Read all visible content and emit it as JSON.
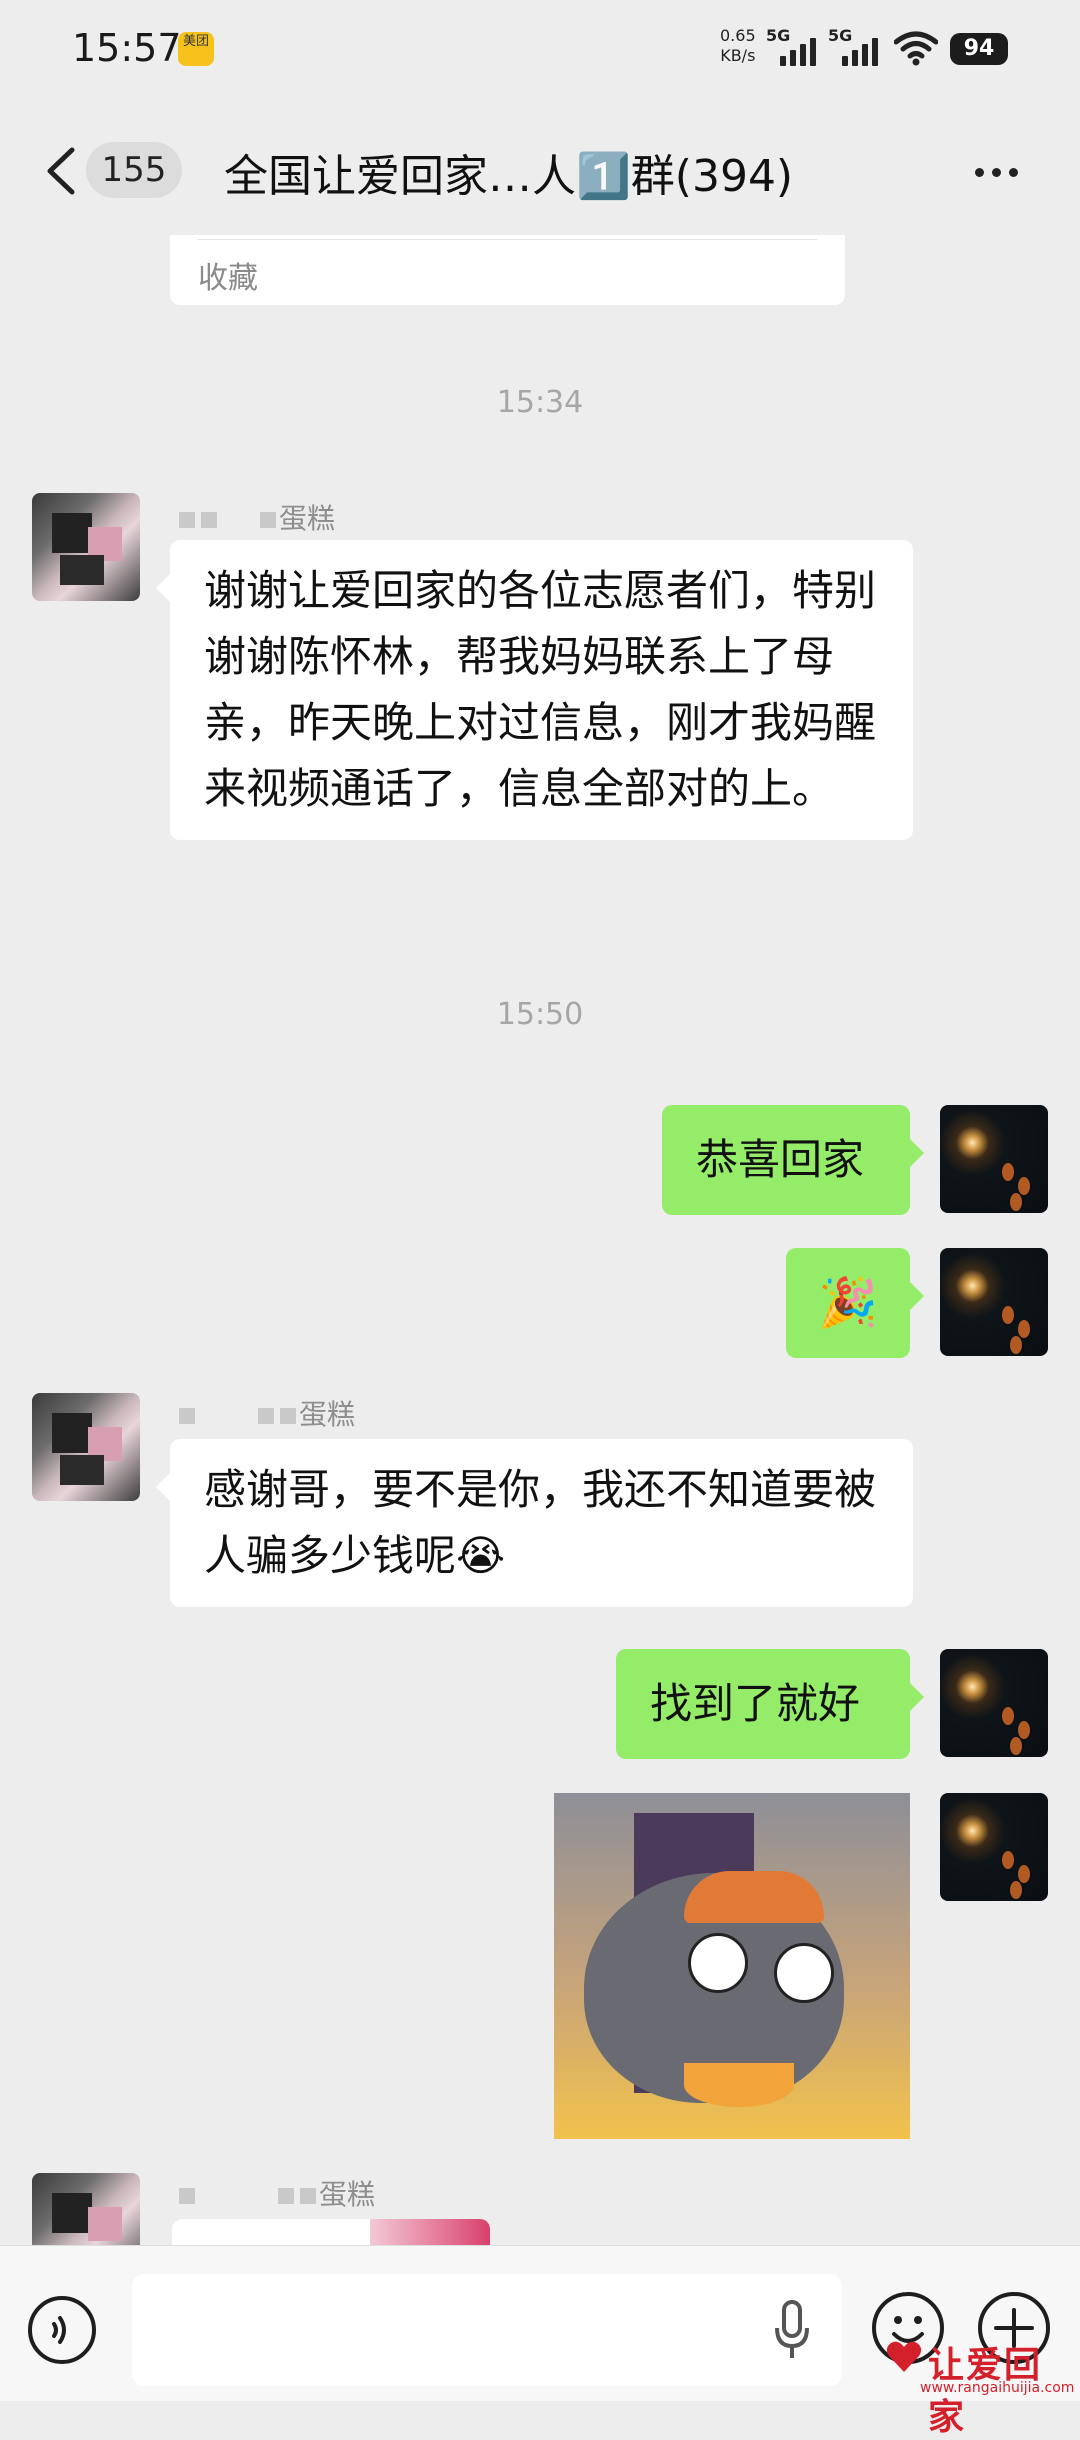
{
  "status_bar": {
    "time": "15:57",
    "app_badge_label": "美团",
    "net_speed_value": "0.65",
    "net_speed_unit": "KB/s",
    "signal_1_label": "5G",
    "signal_2_label": "5G",
    "battery_level": "94"
  },
  "header": {
    "unread_count": "155",
    "chat_title": "全国让爱回家…人1️⃣群(394)"
  },
  "messages": {
    "favorite_card_label": "收藏",
    "time_1": "15:34",
    "sender_1_name": "蛋糕",
    "msg_1_text": "谢谢让爱回家的各位志愿者们，特别谢谢陈怀林，帮我妈妈联系上了母亲，昨天晚上对过信息，刚才我妈醒来视频通话了，信息全部对的上。",
    "time_2": "15:50",
    "msg_2_text": "恭喜回家",
    "msg_3_emoji": "🎉",
    "sender_2_name": "蛋糕",
    "msg_4_text": "感谢哥，要不是你，我还不知道要被人骗多少钱呢😭",
    "msg_5_text": "找到了就好",
    "sender_3_name": "蛋糕"
  },
  "input_bar": {
    "text_value": ""
  },
  "watermark": {
    "brand": "让爱回家",
    "url": "www.rangaihuijia.com"
  },
  "colors": {
    "page_background": "#ededed",
    "outgoing_bubble": "#95ec69",
    "incoming_bubble": "#ffffff",
    "watermark_red": "#d4202a"
  },
  "icons": [
    "back-icon",
    "more-icon",
    "voice-icon",
    "mic-icon",
    "emoji-icon",
    "plus-icon",
    "wifi-icon",
    "signal-icon"
  ]
}
